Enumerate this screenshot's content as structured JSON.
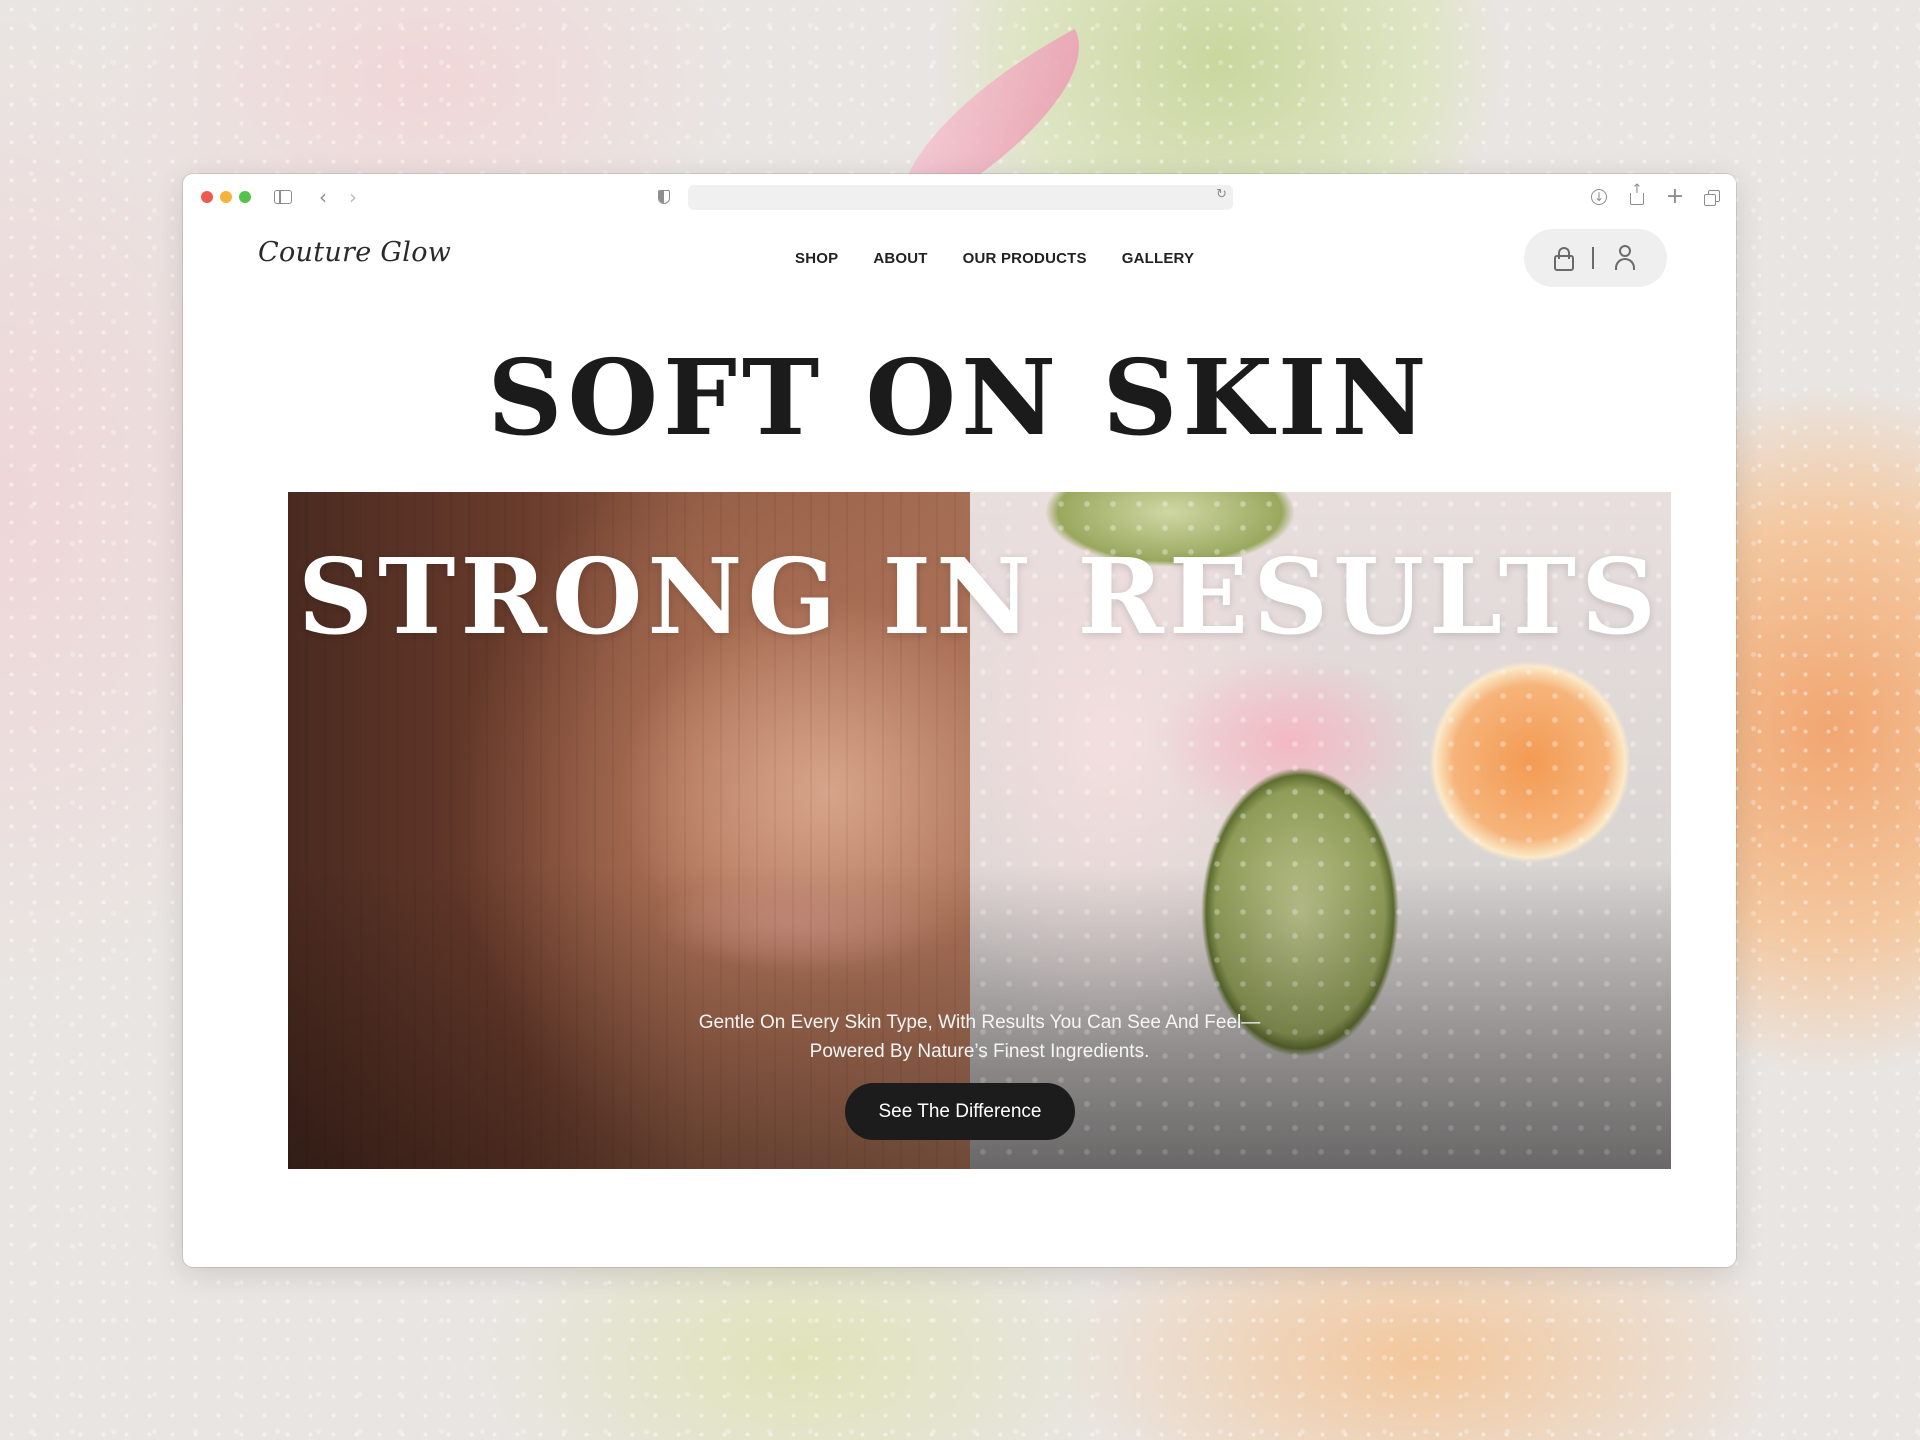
{
  "site": {
    "logo": "Couture Glow",
    "nav": [
      "SHOP",
      "ABOUT",
      "OUR PRODUCTS",
      "GALLERY"
    ]
  },
  "hero": {
    "headline_top": "SOFT ON SKIN",
    "headline_bottom": "STRONG IN RESULTS",
    "subtext_line1": "Gentle On Every Skin Type, With Results You Can See And Feel—",
    "subtext_line2": "Powered By Nature’s Finest Ingredients.",
    "cta_label": "See The Difference"
  },
  "icons": {
    "browser": [
      "sidebar-toggle-icon",
      "back-icon",
      "forward-icon",
      "shield-icon",
      "reload-icon",
      "download-icon",
      "share-icon",
      "new-tab-icon",
      "tabs-overview-icon"
    ],
    "site": [
      "shopping-bag-icon",
      "user-icon"
    ]
  },
  "colors": {
    "cta_background": "#1c1c1c",
    "headline_dark": "#1b1b1b",
    "headline_light": "#ffffff",
    "icon_pill": "#efefef"
  }
}
